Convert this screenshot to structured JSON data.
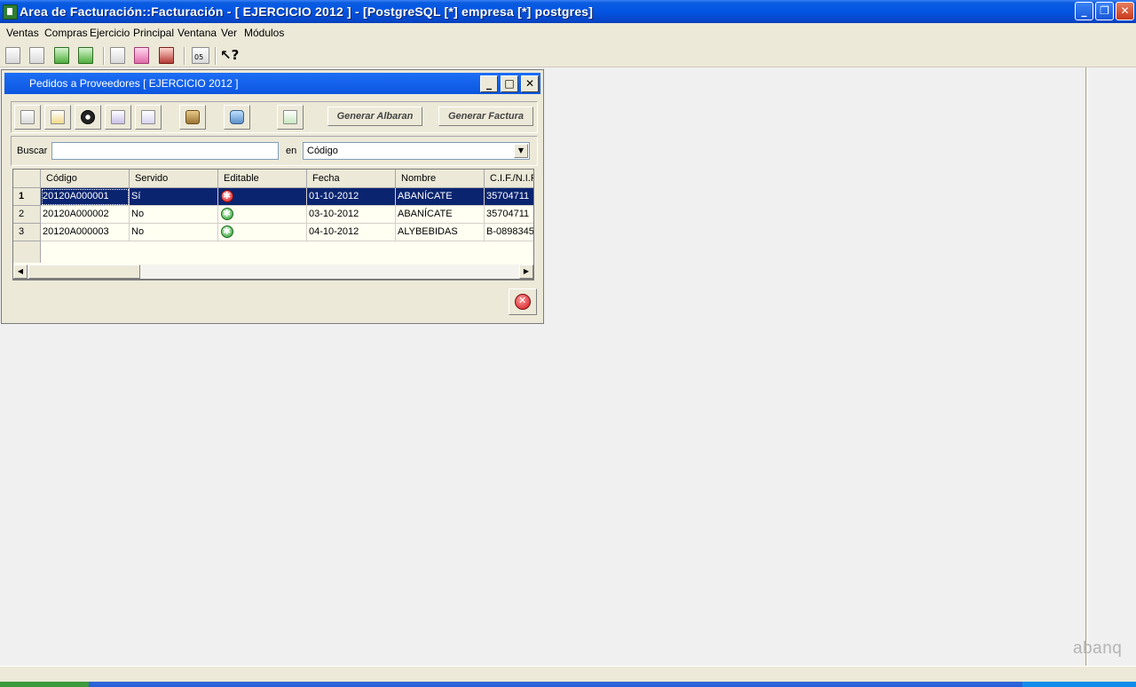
{
  "window": {
    "title": "Area de Facturación::Facturación  - [ EJERCICIO 2012 ] - [PostgreSQL [*] empresa [*] postgres]",
    "controls": {
      "minimize": "_",
      "maximize": "❐",
      "close": "✕"
    }
  },
  "menu": [
    "Ventas",
    "Compras",
    "Ejercicio",
    "Principal",
    "Ventana",
    "Ver",
    "Módulos"
  ],
  "toolbar": {
    "calendar_badge": "05",
    "icons": [
      "edit-doc-icon",
      "blank-doc-icon",
      "green-box-icon",
      "export-icon",
      "page-icon",
      "pink-box-icon",
      "red-tools-icon",
      "calendar-icon",
      "whats-this-icon"
    ]
  },
  "child": {
    "title": "Pedidos a Proveedores [ EJERCICIO 2012 ]",
    "controls": {
      "minimize": "_",
      "maximize": "□",
      "close": "✕"
    },
    "buttons": {
      "generar_albaran": "Generar Albaran",
      "generar_factura": "Generar Factura"
    },
    "search": {
      "label": "Buscar",
      "value": "",
      "en_label": "en",
      "field": "Código"
    },
    "grid": {
      "columns": [
        "Código",
        "Servido",
        "Editable",
        "Fecha",
        "Nombre",
        "C.I.F./N.I.F."
      ],
      "rows": [
        {
          "num": "1",
          "codigo": "20120A000001",
          "servido": "Sí",
          "editable": "no",
          "fecha": "01-10-2012",
          "nombre": "ABANÍCATE",
          "cif": "35704711"
        },
        {
          "num": "2",
          "codigo": "20120A000002",
          "servido": "No",
          "editable": "ok",
          "fecha": "03-10-2012",
          "nombre": "ABANÍCATE",
          "cif": "35704711"
        },
        {
          "num": "3",
          "codigo": "20120A000003",
          "servido": "No",
          "editable": "ok",
          "fecha": "04-10-2012",
          "nombre": "ALYBEBIDAS",
          "cif": "B-0898345"
        }
      ],
      "selected_row": 0
    }
  },
  "watermark": "abanq",
  "colors": {
    "title_blue": "#0454e3",
    "selection": "#0a2470"
  }
}
